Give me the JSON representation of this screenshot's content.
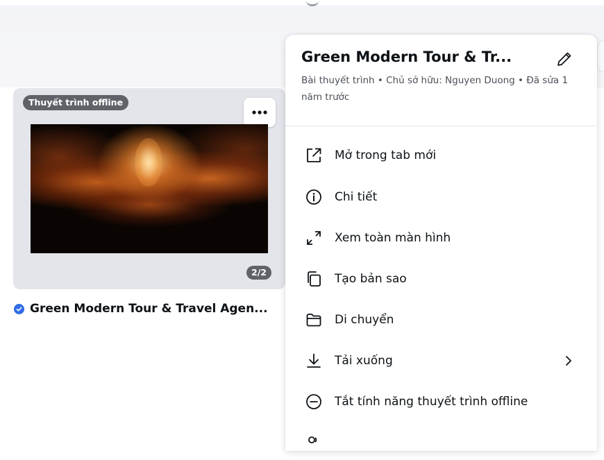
{
  "card": {
    "offline_badge": "Thuyết trình offline",
    "page_count": "2/2",
    "title": "Green Modern Tour & Travel Agen..."
  },
  "menu": {
    "title": "Green Modern Tour & Tr...",
    "meta": "Bài thuyết trình • Chủ sở hữu: Nguyen Duong • Đã sửa 1 năm trước",
    "items": [
      {
        "label": "Mở trong tab mới",
        "icon": "open-in-new-tab-icon"
      },
      {
        "label": "Chi tiết",
        "icon": "info-icon"
      },
      {
        "label": "Xem toàn màn hình",
        "icon": "fullscreen-icon"
      },
      {
        "label": "Tạo bản sao",
        "icon": "copy-icon"
      },
      {
        "label": "Di chuyển",
        "icon": "folder-icon"
      },
      {
        "label": "Tải xuống",
        "icon": "download-icon"
      },
      {
        "label": "Tắt tính năng thuyết trình offline",
        "icon": "minus-circle-icon"
      }
    ]
  },
  "colors": {
    "accent_blue": "#2f6ce5",
    "badge_gray": "#5f6368",
    "text_dark": "#0d1216"
  }
}
